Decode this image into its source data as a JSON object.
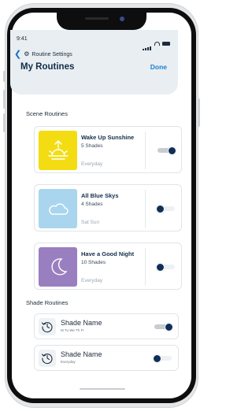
{
  "status": {
    "time": "9:41"
  },
  "header": {
    "breadcrumb": "Routine Settings",
    "title": "My Routines",
    "done_label": "Done"
  },
  "scene_section": {
    "label": "Scene Routines",
    "items": [
      {
        "name": "Wake Up Sunshine",
        "shades": "5 Shades",
        "days": "Everyday",
        "enabled": true,
        "color": "#f3dd12",
        "icon": "sunrise-icon"
      },
      {
        "name": "All Blue Skys",
        "shades": "4 Shades",
        "days": "Sat Sun",
        "enabled": false,
        "color": "#a9d6ee",
        "icon": "cloud-icon"
      },
      {
        "name": "Have a Good Night",
        "shades": "10 Shades",
        "days": "Everyday",
        "enabled": false,
        "color": "#9a7fc0",
        "icon": "moon-icon"
      }
    ]
  },
  "shade_section": {
    "label": "Shade Routines",
    "items": [
      {
        "name": "Shade Name",
        "days": "M Tu We Th Fr",
        "enabled": true,
        "icon": "clock-icon"
      },
      {
        "name": "Shade Name",
        "days": "Everyday",
        "enabled": false,
        "icon": "clock-icon"
      }
    ]
  },
  "colors": {
    "accent": "#1d7fd0",
    "title": "#122d4a",
    "header_bg": "#e8eef2",
    "toggle_knob": "#102f57"
  }
}
